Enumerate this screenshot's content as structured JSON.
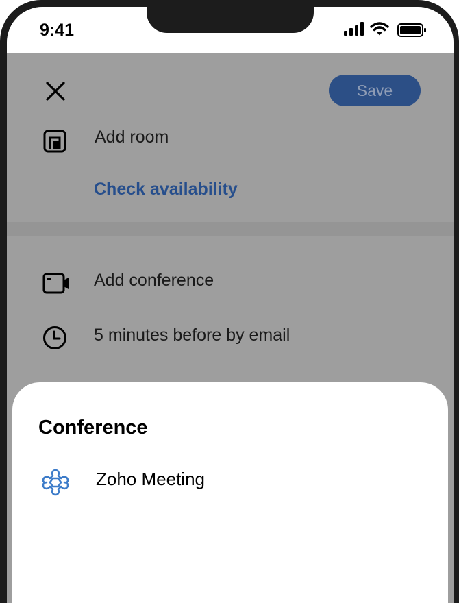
{
  "status_bar": {
    "time": "9:41"
  },
  "header": {
    "save_label": "Save"
  },
  "room": {
    "label": "Add room",
    "check_availability": "Check availability"
  },
  "conference": {
    "label": "Add conference"
  },
  "reminder": {
    "label": "5 minutes before by email"
  },
  "sheet": {
    "title": "Conference",
    "options": [
      {
        "label": "Zoho Meeting",
        "icon": "zoho-meeting-icon"
      }
    ]
  },
  "colors": {
    "accent": "#2c4f86",
    "link": "#264e8c",
    "overlay": "#9e9e9e",
    "zoho_icon": "#3d7cc9"
  }
}
